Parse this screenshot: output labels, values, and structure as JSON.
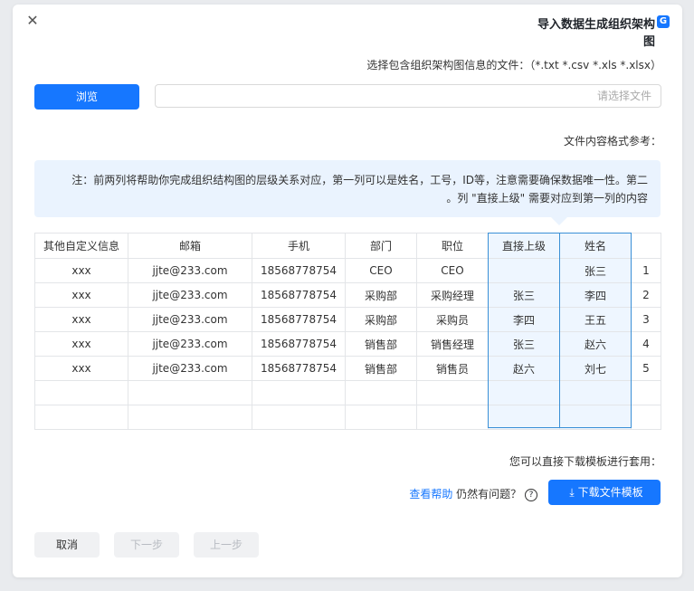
{
  "dialog": {
    "title": "导入数据生成组织架构图",
    "title_icon": "app-logo-icon"
  },
  "file_select": {
    "label": "选择包含组织架构图信息的文件：（*.txt *.csv *.xls *.xlsx）",
    "placeholder": "请选择文件",
    "browse_label": "浏览"
  },
  "format_reference": {
    "label": "文件内容格式参考：",
    "note_line1": "注：前两列将帮助你完成组织结构图的层级关系对应，第一列可以是姓名，工号，ID等，注意需要确保数据唯一性。第二",
    "note_line2": "列 \"直接上级\" 需要对应到第一列的内容。"
  },
  "table": {
    "headers": [
      "",
      "姓名",
      "直接上级",
      "职位",
      "部门",
      "手机",
      "邮箱",
      "其他自定义信息"
    ],
    "rows": [
      [
        "1",
        "张三",
        "",
        "CEO",
        "CEO",
        "18568778754",
        "jjte@233.com",
        "xxx"
      ],
      [
        "2",
        "李四",
        "张三",
        "采购经理",
        "采购部",
        "18568778754",
        "jjte@233.com",
        "xxx"
      ],
      [
        "3",
        "王五",
        "李四",
        "采购员",
        "采购部",
        "18568778754",
        "jjte@233.com",
        "xxx"
      ],
      [
        "4",
        "赵六",
        "张三",
        "销售经理",
        "销售部",
        "18568778754",
        "jjte@233.com",
        "xxx"
      ],
      [
        "5",
        "刘七",
        "赵六",
        "销售员",
        "销售部",
        "18568778754",
        "jjte@233.com",
        "xxx"
      ],
      [
        "",
        "",
        "",
        "",
        "",
        "",
        "",
        ""
      ],
      [
        "",
        "",
        "",
        "",
        "",
        "",
        "",
        ""
      ]
    ]
  },
  "template": {
    "label": "您可以直接下载模板进行套用：",
    "download_label": "下载文件模板",
    "help_prefix": "仍然有问题？",
    "help_link": "查看帮助"
  },
  "footer": {
    "prev_label": "上一步",
    "next_label": "下一步",
    "cancel_label": "取消"
  },
  "colors": {
    "primary": "#1677ff",
    "note_bg": "#eaf3fe",
    "highlight_bg": "#eef6ff"
  }
}
